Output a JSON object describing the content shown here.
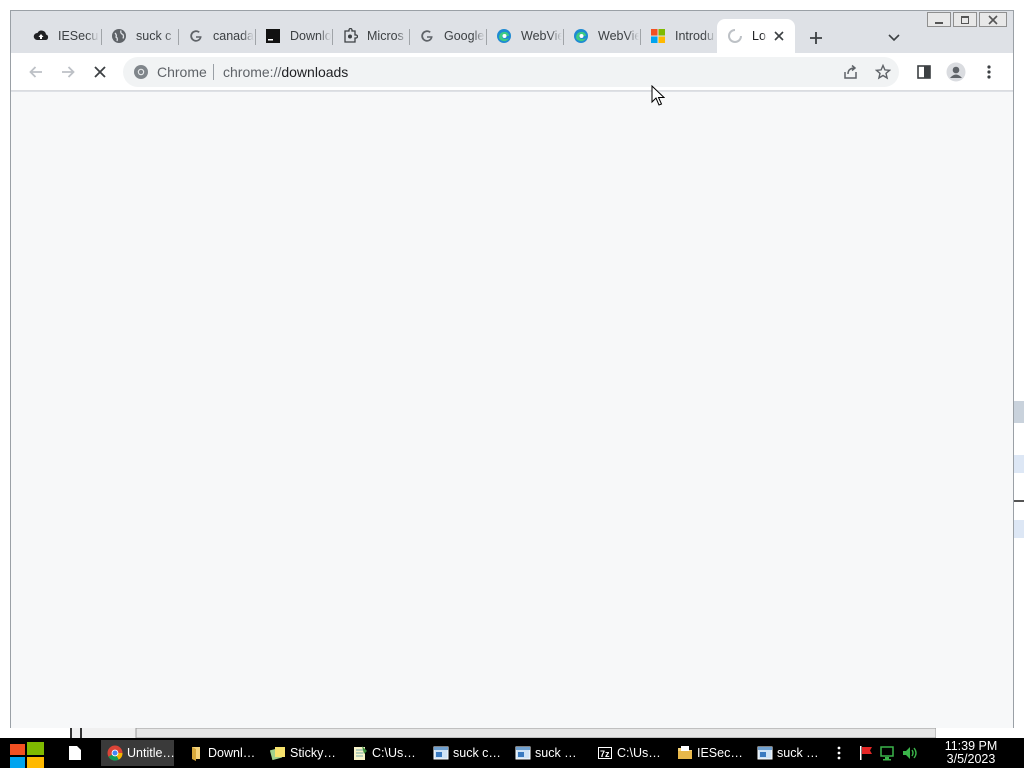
{
  "window": {
    "controls": {
      "minimize": "minimize-icon",
      "maximize": "restore-icon",
      "close": "close-icon"
    }
  },
  "tabs": [
    {
      "title": "IESecurity",
      "icon": "cloud-upload-icon"
    },
    {
      "title": "suck c",
      "icon": "globe-icon"
    },
    {
      "title": "canada",
      "icon": "google-icon"
    },
    {
      "title": "Download",
      "icon": "terminal-icon"
    },
    {
      "title": "Micros",
      "icon": "puzzle-icon"
    },
    {
      "title": "Google",
      "icon": "google-icon"
    },
    {
      "title": "WebView",
      "icon": "edge-icon"
    },
    {
      "title": "WebView",
      "icon": "edge-icon"
    },
    {
      "title": "Introdu",
      "icon": "microsoft-icon"
    },
    {
      "title": "Loading",
      "icon": "loading-spinner-icon",
      "active": true
    }
  ],
  "toolbar": {
    "omnibox_chip": "Chrome",
    "url_scheme": "chrome://",
    "url_path": "downloads"
  },
  "taskbar": {
    "items": [
      {
        "label": "Untitle…",
        "icon": "chrome-icon",
        "active": true
      },
      {
        "label": "Downl…",
        "icon": "folder-icon"
      },
      {
        "label": "Sticky…",
        "icon": "sticky-notes-icon"
      },
      {
        "label": "C:\\Us…",
        "icon": "notepad-icon"
      },
      {
        "label": "suck c…",
        "icon": "window-icon"
      },
      {
        "label": "suck …",
        "icon": "window-icon"
      },
      {
        "label": "C:\\Us…",
        "icon": "7zip-icon"
      },
      {
        "label": "IESec…",
        "icon": "folder-icon"
      },
      {
        "label": "suck …",
        "icon": "window-icon"
      }
    ],
    "clock_time": "11:39 PM",
    "clock_date": "3/5/2023"
  },
  "colors": {
    "tab_strip": "#dee1e6",
    "toolbar": "#ffffff",
    "omnibox": "#f1f3f4",
    "content": "#f7f8f9",
    "taskbar": "#000000"
  }
}
